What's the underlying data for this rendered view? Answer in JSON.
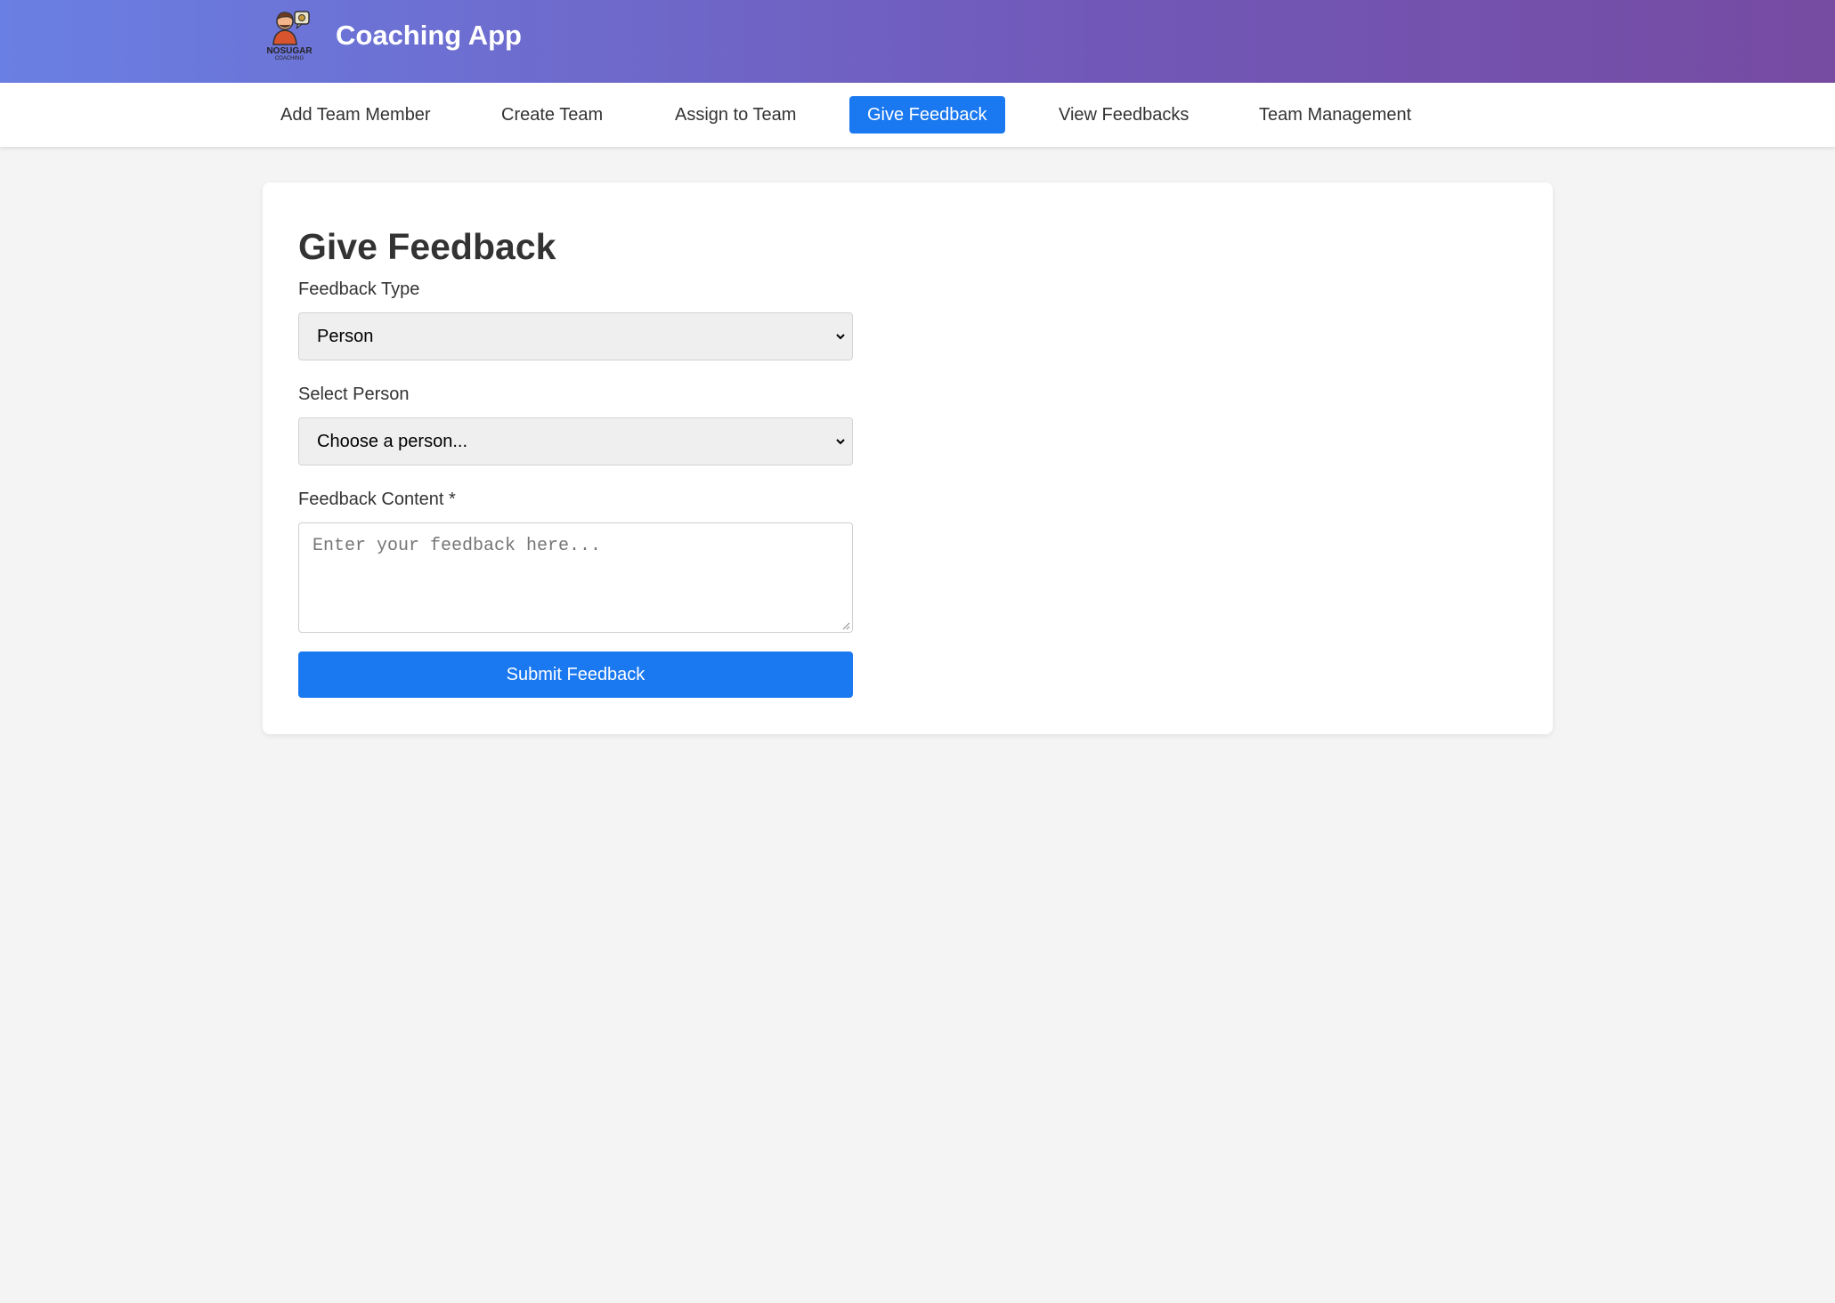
{
  "header": {
    "title": "Coaching App",
    "logo_icon": "nosugar-coaching-logo-icon",
    "logo_text_top": "NOSUGAR",
    "logo_text_bottom": "COACHING"
  },
  "nav": {
    "items": [
      {
        "label": "Add Team Member"
      },
      {
        "label": "Create Team"
      },
      {
        "label": "Assign to Team"
      },
      {
        "label": "Give Feedback",
        "active": true
      },
      {
        "label": "View Feedbacks"
      },
      {
        "label": "Team Management"
      }
    ]
  },
  "form": {
    "title": "Give Feedback",
    "feedback_type_label": "Feedback Type",
    "feedback_type_value": "Person",
    "select_person_label": "Select Person",
    "select_person_value": "Choose a person...",
    "content_label": "Feedback Content *",
    "content_placeholder": "Enter your feedback here...",
    "submit_label": "Submit Feedback"
  },
  "colors": {
    "header_gradient_start": "#6a7fe3",
    "header_gradient_end": "#764ba2",
    "accent": "#1a78f0",
    "page_background": "#f4f4f4"
  }
}
